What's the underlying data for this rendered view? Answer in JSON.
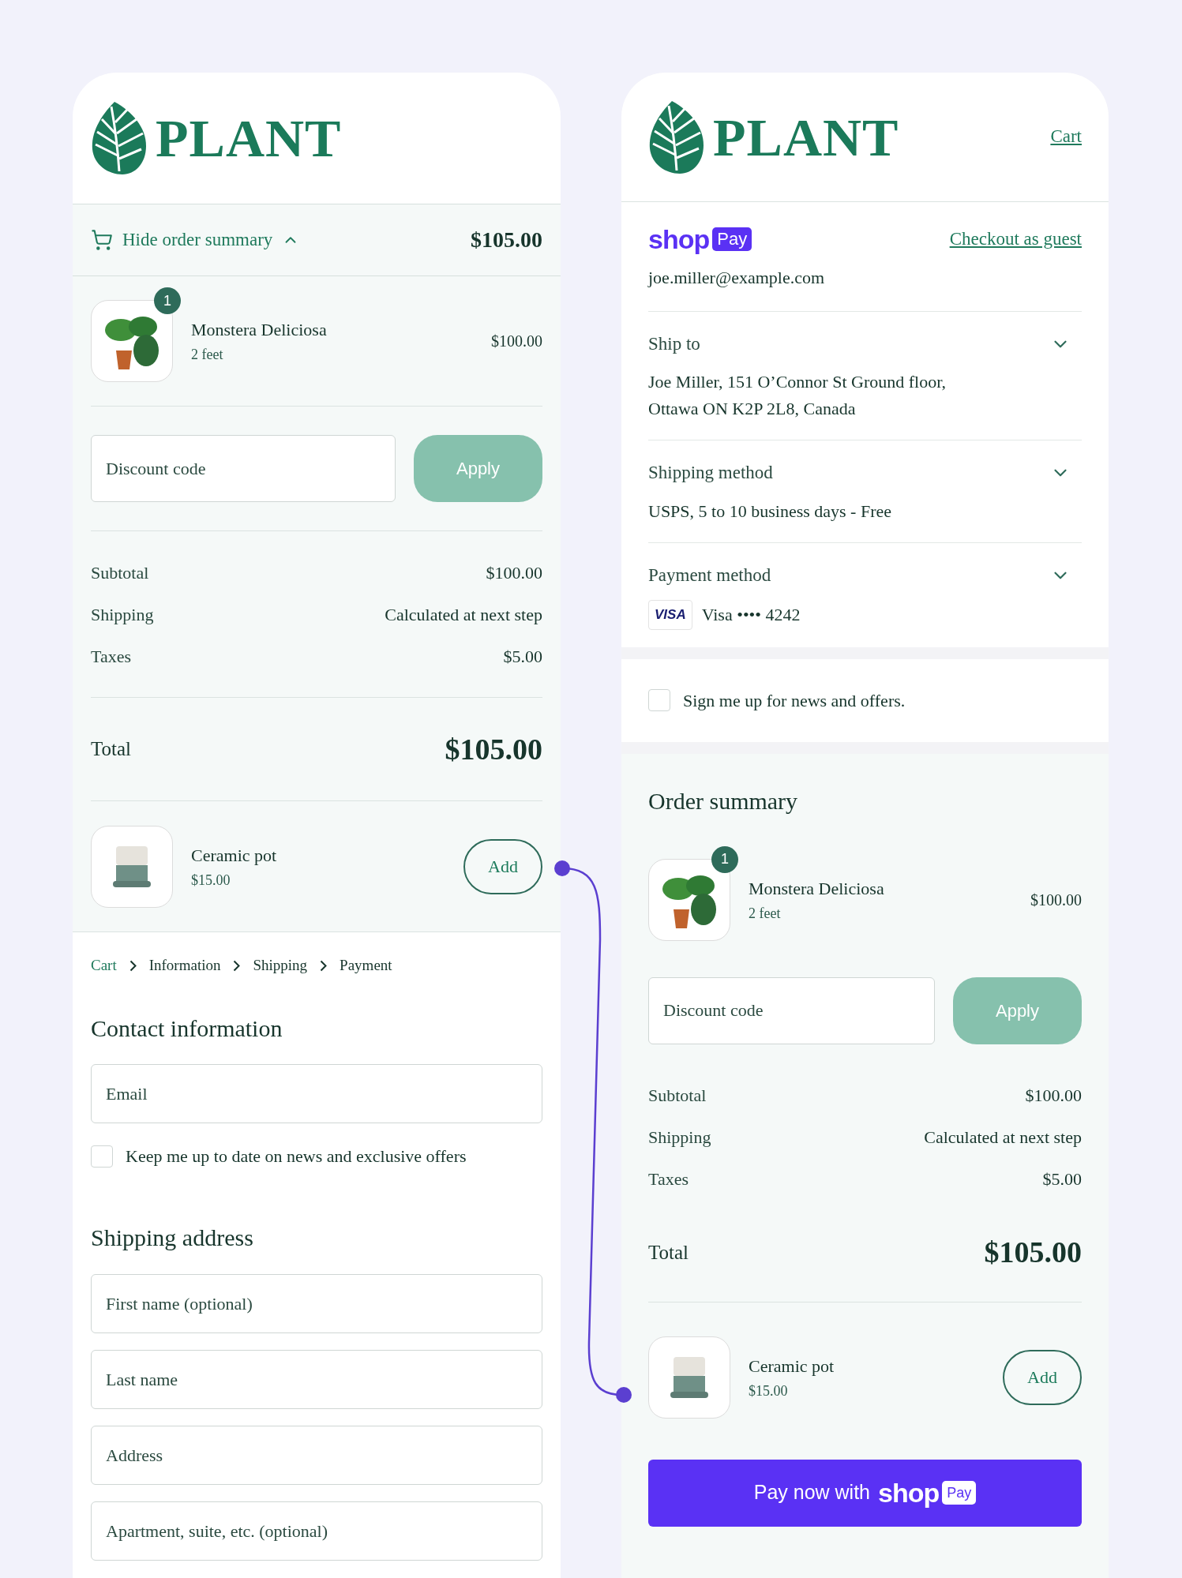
{
  "left_panel": {
    "logo_text": "PLANT",
    "summary_toggle": {
      "label": "Hide order summary",
      "expanded": true,
      "amount": "$105.00"
    },
    "order_summary": {
      "items": [
        {
          "name": "Monstera Deliciosa",
          "variant": "2 feet",
          "quantity": "1",
          "price": "$100.00"
        }
      ],
      "discount": {
        "placeholder": "Discount code",
        "button": "Apply"
      },
      "lines": [
        {
          "label": "Subtotal",
          "value": "$100.00"
        },
        {
          "label": "Shipping",
          "value": "Calculated at next step"
        },
        {
          "label": "Taxes",
          "value": "$5.00"
        }
      ],
      "total": {
        "label": "Total",
        "value": "$105.00"
      },
      "upsell": {
        "name": "Ceramic pot",
        "price": "$15.00",
        "button": "Add"
      }
    },
    "breadcrumbs": [
      {
        "label": "Cart",
        "kind": "link"
      },
      {
        "label": "Information",
        "kind": "step"
      },
      {
        "label": "Shipping",
        "kind": "step"
      },
      {
        "label": "Payment",
        "kind": "step"
      }
    ],
    "contact": {
      "title": "Contact information",
      "email_placeholder": "Email",
      "newsletter": {
        "label": "Keep me up to date on news and exclusive offers",
        "checked": false
      }
    },
    "shipping_address": {
      "title": "Shipping address",
      "fields": [
        {
          "placeholder": "First name (optional)"
        },
        {
          "placeholder": "Last name"
        },
        {
          "placeholder": "Address"
        },
        {
          "placeholder": "Apartment, suite, etc. (optional)"
        }
      ]
    }
  },
  "right_panel": {
    "logo_text": "PLANT",
    "cart_link": "Cart",
    "shop_pay": {
      "logo_text": "shop",
      "badge": "Pay",
      "guest_link": "Checkout as guest",
      "email": "joe.miller@example.com"
    },
    "sections": [
      {
        "title": "Ship to",
        "expanded": false,
        "lines": [
          "Joe Miller, 151 O’Connor St Ground floor,",
          "Ottawa ON K2P 2L8, Canada"
        ]
      },
      {
        "title": "Shipping method",
        "expanded": false,
        "lines": [
          "USPS, 5 to 10 business days - Free"
        ]
      },
      {
        "title": "Payment method",
        "expanded": false,
        "card_brand": "VISA",
        "lines": [
          "Visa •••• 4242"
        ]
      }
    ],
    "newsletter": {
      "label": "Sign me up for news and offers.",
      "checked": false
    },
    "order_summary": {
      "title": "Order summary",
      "items": [
        {
          "name": "Monstera Deliciosa",
          "variant": "2 feet",
          "quantity": "1",
          "price": "$100.00"
        }
      ],
      "discount": {
        "placeholder": "Discount code",
        "button": "Apply"
      },
      "lines": [
        {
          "label": "Subtotal",
          "value": "$100.00"
        },
        {
          "label": "Shipping",
          "value": "Calculated at next step"
        },
        {
          "label": "Taxes",
          "value": "$5.00"
        }
      ],
      "total": {
        "label": "Total",
        "value": "$105.00"
      },
      "upsell": {
        "name": "Ceramic pot",
        "price": "$15.00",
        "button": "Add"
      }
    },
    "pay_button": {
      "label": "Pay now with",
      "logo_text": "shop",
      "badge": "Pay"
    }
  }
}
